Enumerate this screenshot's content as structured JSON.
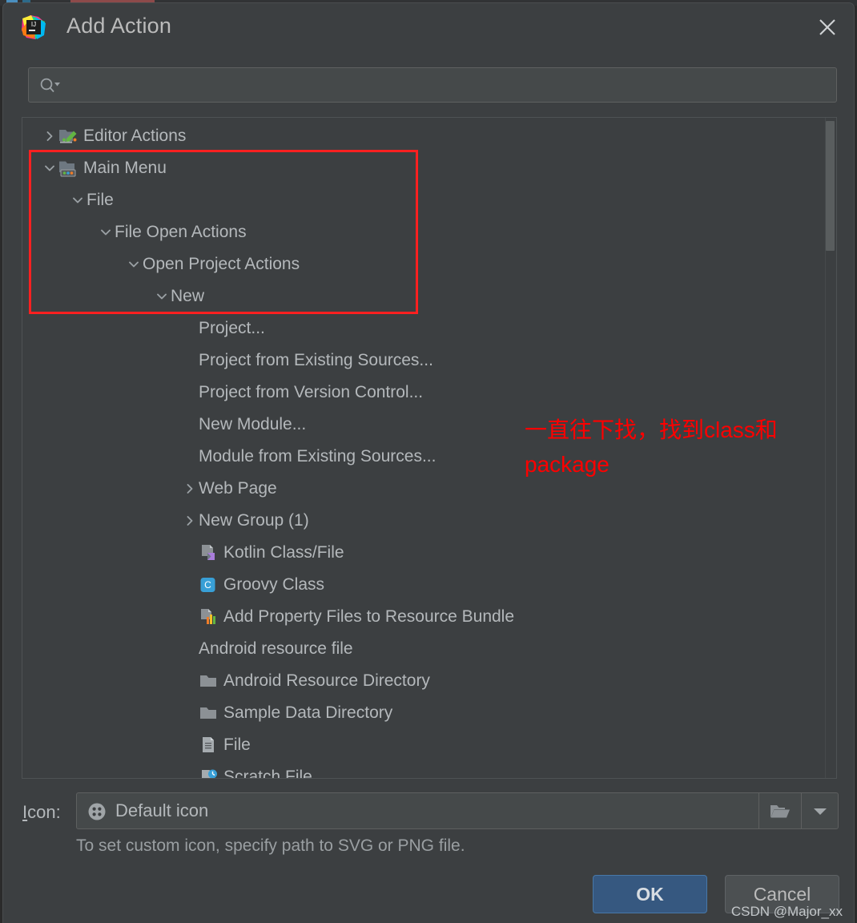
{
  "window": {
    "title": "Add Action",
    "app_icon": "intellij-idea-icon",
    "close_icon": "close-icon"
  },
  "search": {
    "icon": "search-icon",
    "value": "",
    "placeholder": ""
  },
  "tree": {
    "items": [
      {
        "label": "Editor Actions",
        "depth": 0,
        "twisty": "chevron-right",
        "icon": "folder-edit-icon"
      },
      {
        "label": "Main Menu",
        "depth": 0,
        "twisty": "chevron-down",
        "icon": "folder-menu-icon"
      },
      {
        "label": "File",
        "depth": 1,
        "twisty": "chevron-down",
        "icon": "none"
      },
      {
        "label": "File Open Actions",
        "depth": 2,
        "twisty": "chevron-down",
        "icon": "none"
      },
      {
        "label": "Open Project Actions",
        "depth": 3,
        "twisty": "chevron-down",
        "icon": "none"
      },
      {
        "label": "New",
        "depth": 4,
        "twisty": "chevron-down",
        "icon": "none"
      },
      {
        "label": "Project...",
        "depth": 5,
        "twisty": "none",
        "icon": "none"
      },
      {
        "label": "Project from Existing Sources...",
        "depth": 5,
        "twisty": "none",
        "icon": "none"
      },
      {
        "label": "Project from Version Control...",
        "depth": 5,
        "twisty": "none",
        "icon": "none"
      },
      {
        "label": "New Module...",
        "depth": 5,
        "twisty": "none",
        "icon": "none"
      },
      {
        "label": "Module from Existing Sources...",
        "depth": 5,
        "twisty": "none",
        "icon": "none"
      },
      {
        "label": "Web Page",
        "depth": 5,
        "twisty": "chevron-right",
        "icon": "none"
      },
      {
        "label": "New Group (1)",
        "depth": 5,
        "twisty": "chevron-right",
        "icon": "none"
      },
      {
        "label": "Kotlin Class/File",
        "depth": 5,
        "twisty": "none",
        "icon": "kotlin-file-icon"
      },
      {
        "label": "Groovy Class",
        "depth": 5,
        "twisty": "none",
        "icon": "groovy-class-icon"
      },
      {
        "label": "Add Property Files to Resource Bundle",
        "depth": 5,
        "twisty": "none",
        "icon": "resource-bundle-icon"
      },
      {
        "label": "Android resource file",
        "depth": 5,
        "twisty": "none",
        "icon": "none"
      },
      {
        "label": "Android Resource Directory",
        "depth": 5,
        "twisty": "none",
        "icon": "folder-icon"
      },
      {
        "label": "Sample Data Directory",
        "depth": 5,
        "twisty": "none",
        "icon": "folder-icon"
      },
      {
        "label": "File",
        "depth": 5,
        "twisty": "none",
        "icon": "file-icon"
      },
      {
        "label": "Scratch File",
        "depth": 5,
        "twisty": "none",
        "icon": "scratch-file-icon"
      }
    ],
    "scrollbar": "vertical-scrollbar"
  },
  "annotation": {
    "text": "一直往下找，找到class和package",
    "box_color": "#ff2020",
    "text_color": "#ff0000"
  },
  "icon_field": {
    "label": "Icon:",
    "label_mnemonic": "I",
    "label_rest": "con:",
    "value": "Default icon",
    "value_icon": "default-icon-glyph",
    "browse_icon": "folder-browse-icon",
    "dropdown_icon": "chevron-down-icon",
    "hint": "To set custom icon, specify path to SVG or PNG file."
  },
  "buttons": {
    "ok": "OK",
    "cancel": "Cancel",
    "ok_color": "#365880"
  },
  "watermark": {
    "text": "CSDN @Major_xx"
  }
}
